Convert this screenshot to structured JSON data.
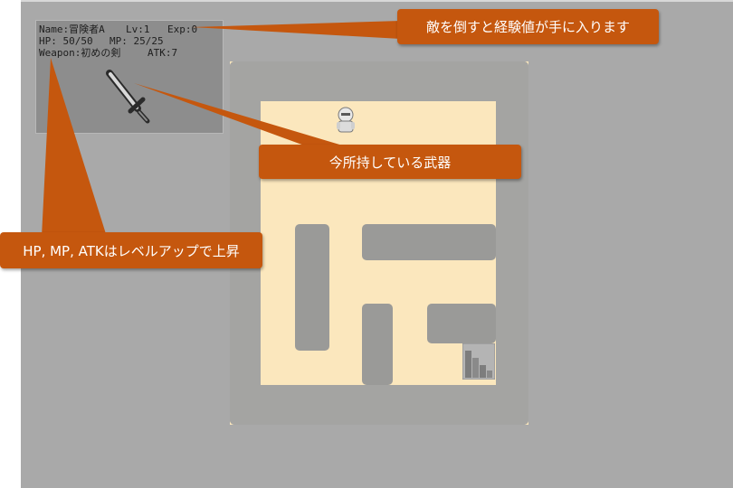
{
  "status": {
    "name": "Name:冒険者A",
    "level": "Lv:1",
    "exp": "Exp:0",
    "hp": "HP: 50/50",
    "mp": "MP: 25/25",
    "weapon": "Weapon:初めの剣",
    "atk": "ATK:7"
  },
  "callouts": {
    "exp": "敵を倒すと経験値が手に入ります",
    "weapon": "今所持している武器",
    "stats": "HP, MP, ATKはレベルアップで上昇"
  },
  "colors": {
    "callout": "#c5570e",
    "background": "#a9a9a9",
    "floor": "#fbe7bd",
    "wall": "#9a9a98"
  },
  "icons": {
    "weapon": "sword-icon",
    "player": "knight-sprite",
    "exit": "stairs-icon"
  }
}
